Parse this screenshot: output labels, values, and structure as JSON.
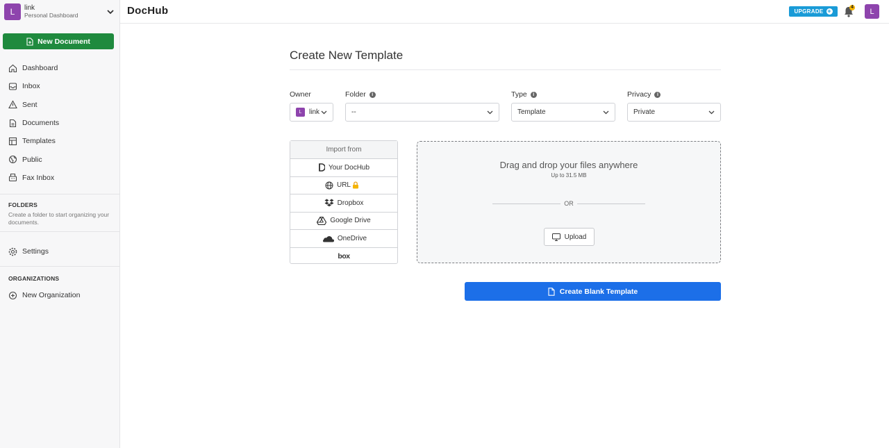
{
  "account": {
    "avatar_letter": "L",
    "name": "link",
    "subtitle": "Personal Dashboard"
  },
  "sidebar": {
    "new_document": "New Document",
    "items": [
      {
        "label": "Dashboard",
        "icon": "home-icon"
      },
      {
        "label": "Inbox",
        "icon": "inbox-icon"
      },
      {
        "label": "Sent",
        "icon": "send-icon"
      },
      {
        "label": "Documents",
        "icon": "document-icon"
      },
      {
        "label": "Templates",
        "icon": "template-icon"
      },
      {
        "label": "Public",
        "icon": "globe-icon"
      },
      {
        "label": "Fax Inbox",
        "icon": "fax-icon"
      }
    ],
    "folders_title": "FOLDERS",
    "folders_desc": "Create a folder to start organizing your documents.",
    "settings": "Settings",
    "organizations_title": "ORGANIZATIONS",
    "new_organization": "New Organization"
  },
  "header": {
    "brand": "DocHub",
    "upgrade": "UPGRADE",
    "notification_count": "4",
    "avatar_letter": "L"
  },
  "form": {
    "title": "Create New Template",
    "owner_label": "Owner",
    "owner_value": "link",
    "owner_avatar": "L",
    "folder_label": "Folder",
    "folder_value": "--",
    "type_label": "Type",
    "type_value": "Template",
    "privacy_label": "Privacy",
    "privacy_value": "Private"
  },
  "import": {
    "header": "Import from",
    "sources": [
      {
        "label": "Your DocHub",
        "icon": "dochub-icon"
      },
      {
        "label": "URL",
        "icon": "globe-icon"
      },
      {
        "label": "Dropbox",
        "icon": "dropbox-icon"
      },
      {
        "label": "Google Drive",
        "icon": "google-drive-icon"
      },
      {
        "label": "OneDrive",
        "icon": "onedrive-icon"
      },
      {
        "label": "box",
        "icon": "box-logo"
      }
    ]
  },
  "dropzone": {
    "title": "Drag and drop your files anywhere",
    "subtitle": "Up to 31.5 MB",
    "or": "OR",
    "upload": "Upload"
  },
  "create_blank": "Create Blank Template",
  "colors": {
    "green": "#1f8a3e",
    "blue": "#1c6fe8",
    "upgrade": "#1a9bd7",
    "avatar": "#8e44ad"
  }
}
